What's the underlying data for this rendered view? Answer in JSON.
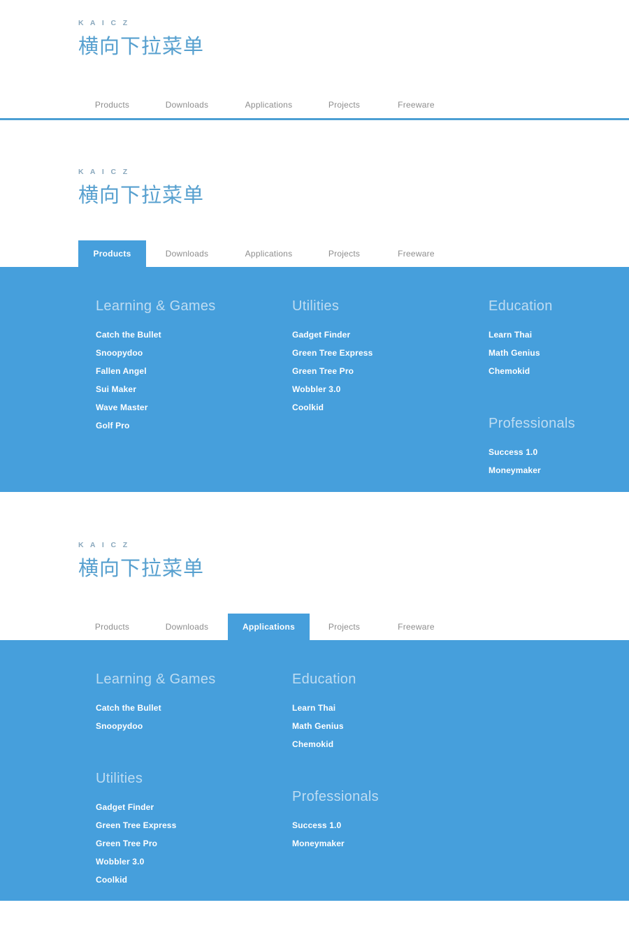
{
  "brand": {
    "logo": "K A I C Z",
    "title": "横向下拉菜单"
  },
  "colors": {
    "accent_blue": "#469fdc",
    "rule_blue": "#4c9fd3",
    "title_blue": "#57a0cf",
    "logo_gray_blue": "#8aa8bd",
    "nav_text_gray": "#8d8d8d",
    "group_title": "#bedcf2",
    "link_white": "#ffffff",
    "page_bg": "#ffffff"
  },
  "nav": {
    "items": [
      {
        "label": "Products",
        "key": "products"
      },
      {
        "label": "Downloads",
        "key": "downloads"
      },
      {
        "label": "Applications",
        "key": "applications"
      },
      {
        "label": "Projects",
        "key": "projects"
      },
      {
        "label": "Freeware",
        "key": "freeware"
      }
    ]
  },
  "sections": [
    {
      "id": "closed-state",
      "active_tab": null,
      "panel_open": false,
      "has_rule": true
    },
    {
      "id": "products-open",
      "active_tab": "Products",
      "panel_open": true,
      "has_rule": false,
      "columns": [
        {
          "groups": [
            {
              "title": "Learning & Games",
              "links": [
                "Catch the Bullet",
                "Snoopydoo",
                "Fallen Angel",
                "Sui Maker",
                "Wave Master",
                "Golf Pro"
              ]
            }
          ]
        },
        {
          "groups": [
            {
              "title": "Utilities",
              "links": [
                "Gadget Finder",
                "Green Tree Express",
                "Green Tree Pro",
                "Wobbler 3.0",
                "Coolkid"
              ]
            }
          ]
        },
        {
          "groups": [
            {
              "title": "Education",
              "links": [
                "Learn Thai",
                "Math Genius",
                "Chemokid"
              ]
            },
            {
              "title": "Professionals",
              "links": [
                "Success 1.0",
                "Moneymaker"
              ]
            }
          ]
        }
      ]
    },
    {
      "id": "applications-open",
      "active_tab": "Applications",
      "panel_open": true,
      "has_rule": false,
      "columns": [
        {
          "groups": [
            {
              "title": "Learning & Games",
              "links": [
                "Catch the Bullet",
                "Snoopydoo"
              ]
            },
            {
              "title": "Utilities",
              "links": [
                "Gadget Finder",
                "Green Tree Express",
                "Green Tree Pro",
                "Wobbler 3.0",
                "Coolkid"
              ]
            }
          ]
        },
        {
          "groups": [
            {
              "title": "Education",
              "links": [
                "Learn Thai",
                "Math Genius",
                "Chemokid"
              ]
            },
            {
              "title": "Professionals",
              "links": [
                "Success 1.0",
                "Moneymaker"
              ]
            }
          ]
        }
      ]
    }
  ]
}
